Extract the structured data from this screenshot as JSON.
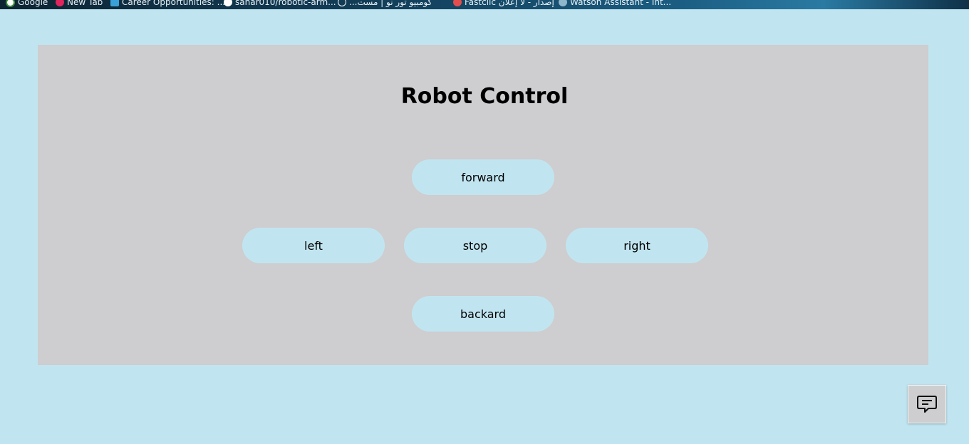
{
  "bookmarks": [
    {
      "label": "Google",
      "icon": "google-icon",
      "color": "#ffffff"
    },
    {
      "label": "New Tab",
      "icon": "new-tab-icon",
      "color": "#e0245e"
    },
    {
      "label": "Career Opportunities: ...",
      "icon": "career-icon",
      "color": "#3aa0d8"
    },
    {
      "label": "sahar010/robotic-arm...",
      "icon": "github-icon",
      "color": "#ffffff"
    },
    {
      "label": "...كومبيو تور نو | مست",
      "icon": "globe-icon",
      "color": "#ffffff"
    },
    {
      "label": "Fastclic إصدار - لا إعلان",
      "icon": "fastclic-icon",
      "color": "#e44d4d"
    },
    {
      "label": "Watson Assistant - Int...",
      "icon": "watson-icon",
      "color": "#8fb7cc"
    }
  ],
  "page": {
    "title": "Robot Control"
  },
  "controls": {
    "forward": "forward",
    "left": "left",
    "stop": "stop",
    "right": "right",
    "backward": "backard"
  },
  "chat": {
    "icon": "chat-icon"
  },
  "colors": {
    "background": "#c1e5f0",
    "panel": "#cecdcf",
    "button": "#c1e5f0"
  }
}
